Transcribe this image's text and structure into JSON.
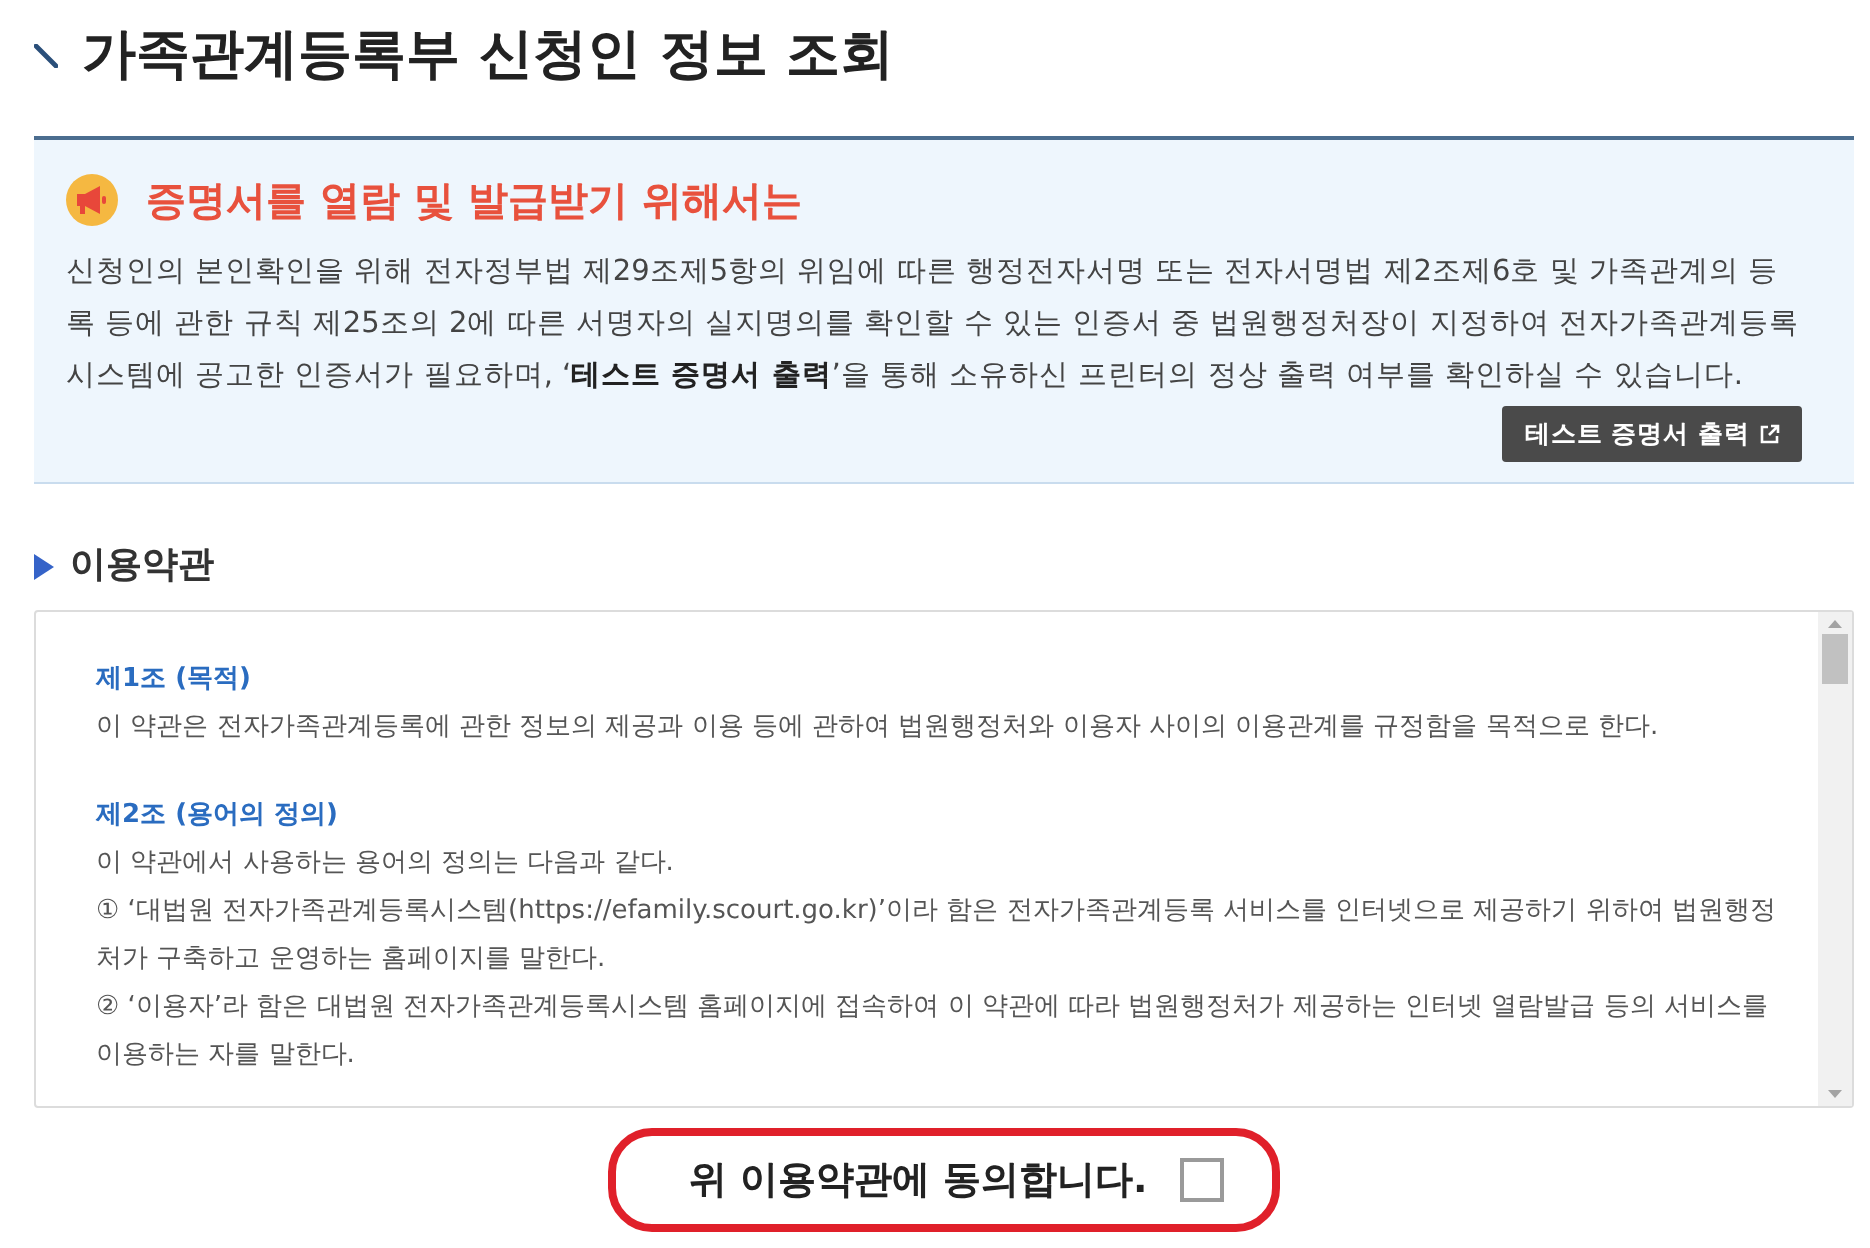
{
  "page": {
    "title": "가족관계등록부 신청인 정보 조회"
  },
  "notice": {
    "heading": "증명서를 열람 및 발급받기 위해서는",
    "text": "신청인의 본인확인을 위해 전자정부법 제29조제5항의 위임에 따른 행정전자서명 또는 전자서명법 제2조제6호 및 가족관계의 등록 등에 관한 규칙 제25조의 2에 따른 서명자의 실지명의를 확인할 수 있는 인증서 중 법원행정처장이 지정하여 전자가족관계등록시스템에 공고한 인증서가 필요하며, ‘**테스트 증명서 출력**’을 통해 소유하신 프린터의 정상 출력 여부를 확인하실 수 있습니다.",
    "button": {
      "label": "테스트 증명서 출력"
    }
  },
  "terms": {
    "heading": "이용약관",
    "articles": [
      {
        "title": "제1조 (목적)",
        "paragraphs": [
          "이 약관은 전자가족관계등록에 관한 정보의 제공과 이용 등에 관하여 법원행정처와 이용자 사이의 이용관계를 규정함을 목적으로 한다."
        ]
      },
      {
        "title": "제2조 (용어의 정의)",
        "paragraphs": [
          "이 약관에서 사용하는 용어의 정의는 다음과 같다.",
          "① ‘대법원 전자가족관계등록시스템(https://efamily.scourt.go.kr)’이라 함은 전자가족관계등록 서비스를 인터넷으로 제공하기 위하여 법원행정처가 구축하고 운영하는 홈페이지를 말한다.",
          "② ‘이용자’라 함은 대법원 전자가족관계등록시스템 홈페이지에 접속하여 이 약관에 따라 법원행정처가 제공하는 인터넷 열람발급 등의 서비스를 이용하는 자를 말한다."
        ]
      }
    ]
  },
  "agreement": {
    "label": "위 이용약관에 동의합니다.",
    "checked": false
  }
}
